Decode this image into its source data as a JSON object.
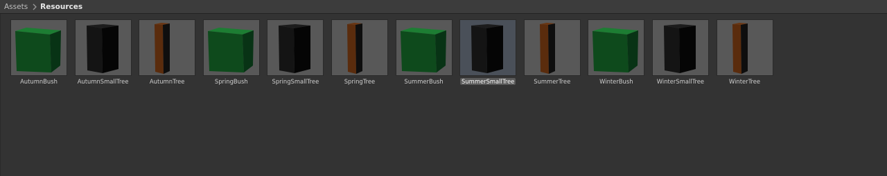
{
  "breadcrumb": {
    "root": "Assets",
    "current": "Resources"
  },
  "colors": {
    "bush_front": "#0e4a1c",
    "bush_top": "#1d7d33",
    "bush_side": "#083315",
    "trunk_front": "#5a2c0d",
    "trunk_side": "#0e0e0e",
    "small_front": "#141414",
    "small_side": "#050505"
  },
  "assets": [
    {
      "name": "AutumnBush",
      "shape": "bush-cube-icon",
      "selected": false
    },
    {
      "name": "AutumnSmallTree",
      "shape": "small-tree-block-icon",
      "selected": false
    },
    {
      "name": "AutumnTree",
      "shape": "tree-trunk-icon",
      "selected": false
    },
    {
      "name": "SpringBush",
      "shape": "bush-cube-icon",
      "selected": false
    },
    {
      "name": "SpringSmallTree",
      "shape": "small-tree-block-icon",
      "selected": false
    },
    {
      "name": "SpringTree",
      "shape": "tree-trunk-icon",
      "selected": false
    },
    {
      "name": "SummerBush",
      "shape": "bush-cube-icon",
      "selected": false
    },
    {
      "name": "SummerSmallTree",
      "shape": "small-tree-block-icon",
      "selected": true
    },
    {
      "name": "SummerTree",
      "shape": "tree-trunk-icon",
      "selected": false
    },
    {
      "name": "WinterBush",
      "shape": "bush-cube-icon",
      "selected": false
    },
    {
      "name": "WinterSmallTree",
      "shape": "small-tree-block-icon",
      "selected": false
    },
    {
      "name": "WinterTree",
      "shape": "tree-trunk-icon",
      "selected": false
    }
  ]
}
